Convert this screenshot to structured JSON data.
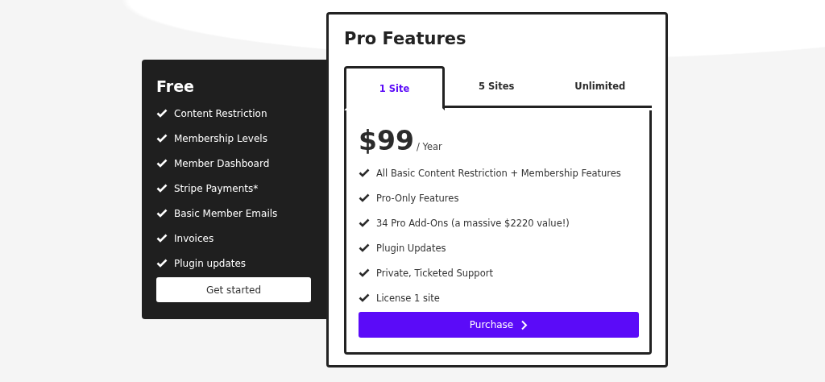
{
  "free_plan": {
    "title": "Free",
    "features": [
      "Content Restriction",
      "Membership Levels",
      "Member Dashboard",
      "Stripe Payments*",
      "Basic Member Emails",
      "Invoices",
      "Plugin updates"
    ],
    "button": "Get started"
  },
  "pro_plan": {
    "title": "Pro Features",
    "tabs": [
      {
        "label": "1 Site",
        "selected": true
      },
      {
        "label": "5 Sites",
        "selected": false
      },
      {
        "label": "Unlimited",
        "selected": false
      }
    ],
    "price": "$99",
    "period": "/ Year",
    "features": [
      "All Basic Content Restriction + Membership Features",
      "Pro-Only Features",
      "34 Pro Add-Ons (a massive $2220 value!)",
      "Plugin Updates",
      "Private, Ticketed Support",
      "License 1 site"
    ],
    "button": "Purchase"
  }
}
